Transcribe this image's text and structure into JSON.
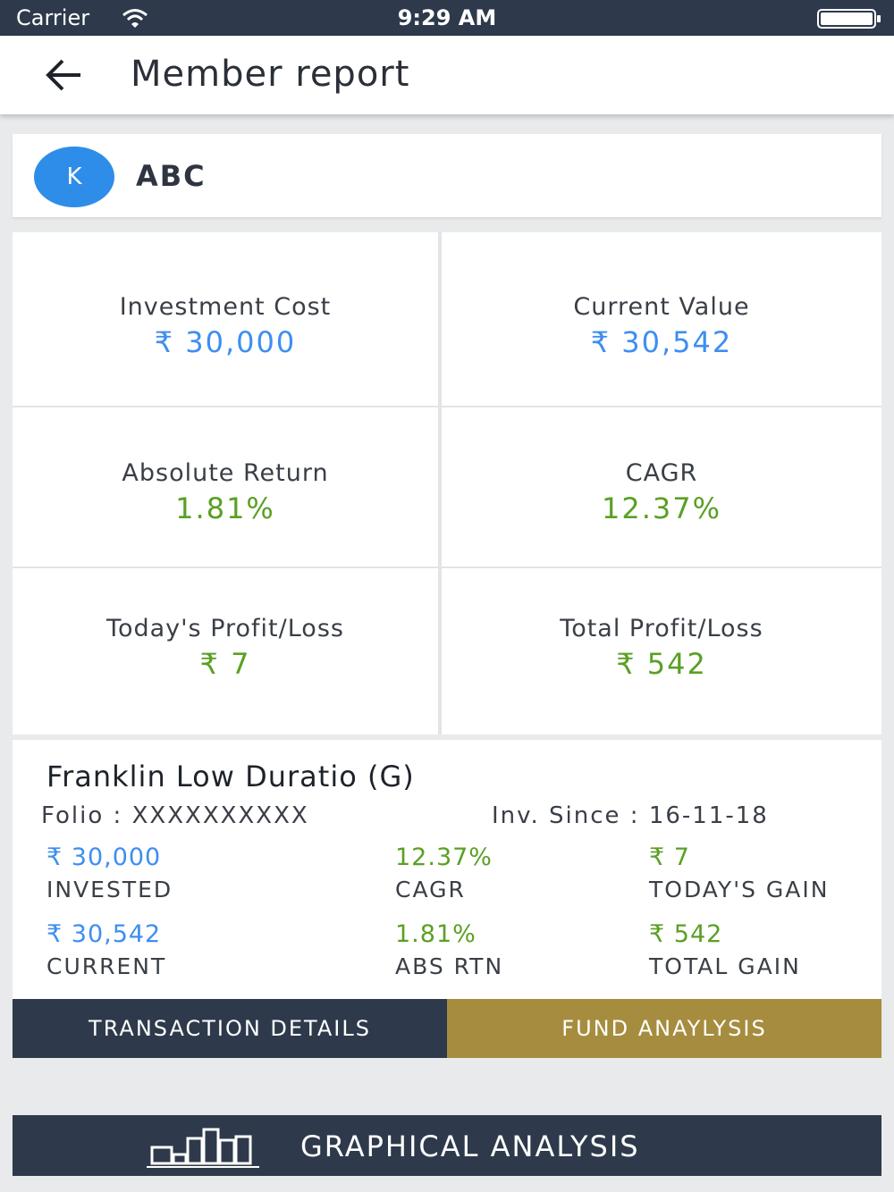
{
  "status_bar": {
    "carrier": "Carrier",
    "time": "9:29 AM"
  },
  "app_bar": {
    "title": "Member report"
  },
  "member": {
    "initial": "K",
    "name": "ABC"
  },
  "summary": {
    "investment_cost": {
      "label": "Investment Cost",
      "value": "₹ 30,000"
    },
    "current_value": {
      "label": "Current Value",
      "value": "₹ 30,542"
    },
    "absolute_return": {
      "label": "Absolute Return",
      "value": "1.81%"
    },
    "cagr": {
      "label": "CAGR",
      "value": "12.37%"
    },
    "todays_pl": {
      "label": "Today's Profit/Loss",
      "value": "₹ 7"
    },
    "total_pl": {
      "label": "Total Profit/Loss",
      "value": "₹ 542"
    }
  },
  "fund": {
    "name": "Franklin Low Duratio (G)",
    "folio": "Folio :  XXXXXXXXXX",
    "inv_since": "Inv. Since : 16-11-18",
    "stats": {
      "invested": {
        "value": "₹ 30,000",
        "label": "INVESTED"
      },
      "cagr": {
        "value": "12.37%",
        "label": "CAGR"
      },
      "todays_gain": {
        "value": "₹ 7",
        "label": "TODAY'S GAIN"
      },
      "current": {
        "value": "₹ 30,542",
        "label": "CURRENT"
      },
      "abs_rtn": {
        "value": "1.81%",
        "label": "ABS RTN"
      },
      "total_gain": {
        "value": "₹ 542",
        "label": "TOTAL GAIN"
      }
    }
  },
  "buttons": {
    "transaction_details": "TRANSACTION DETAILS",
    "fund_analysis": "FUND ANAYLYSIS",
    "graphical_analysis": "GRAPHICAL ANALYSIS"
  },
  "colors": {
    "status_bar": "#2e3a4b",
    "accent_blue": "#3e8ef0",
    "accent_green": "#5aa024",
    "gold_button": "#a68c3e",
    "avatar": "#2e8de8"
  },
  "icons": [
    "wifi-icon",
    "battery-icon",
    "back-arrow-icon",
    "bar-chart-icon"
  ]
}
